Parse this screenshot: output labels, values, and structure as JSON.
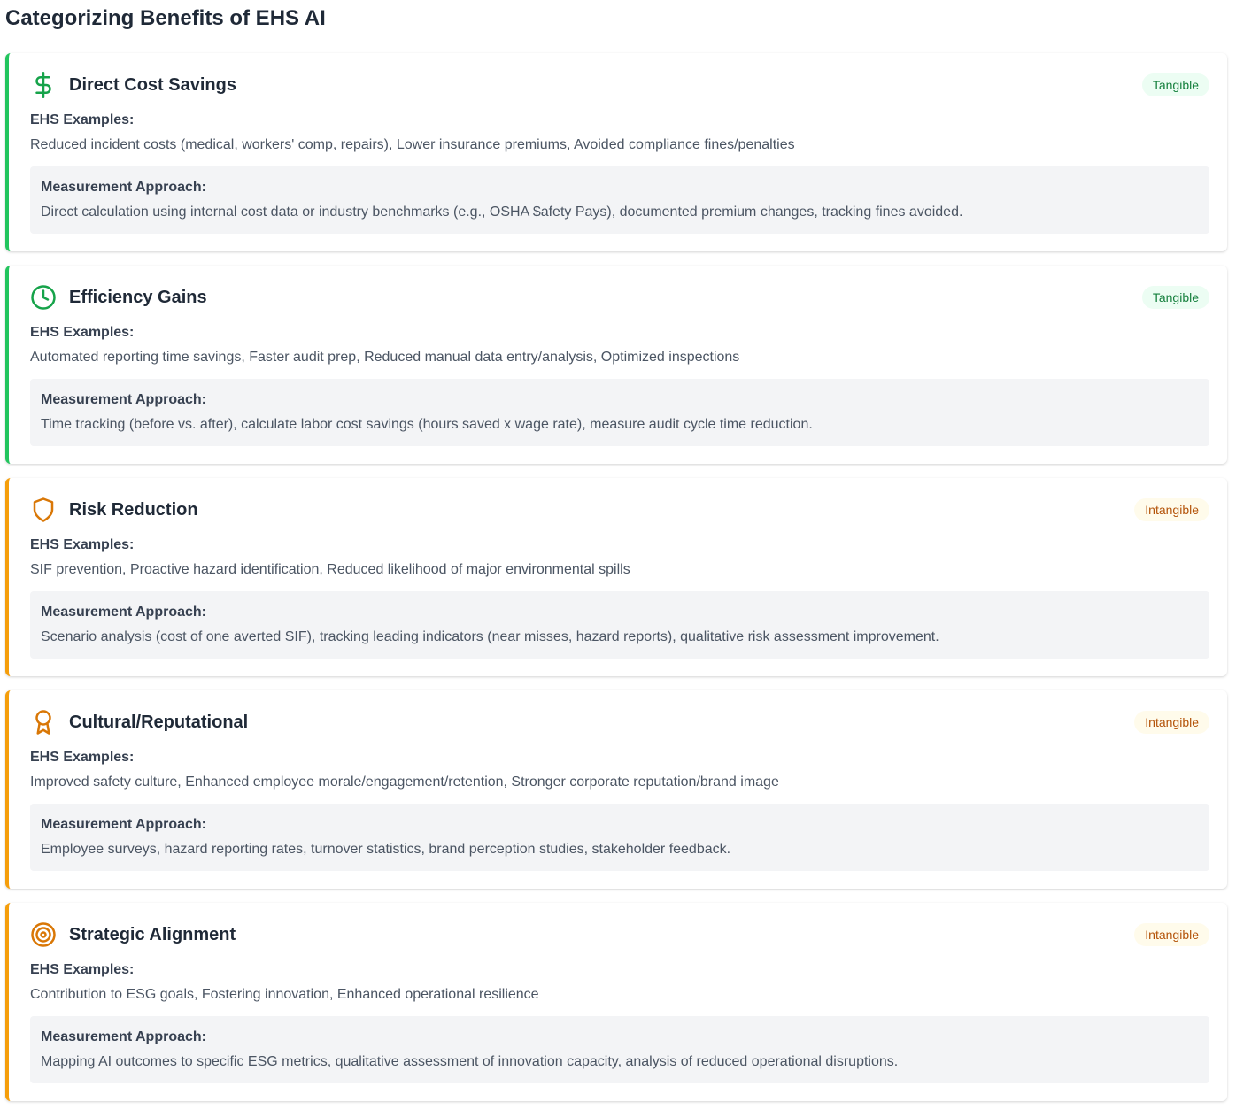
{
  "page": {
    "title": "Categorizing Benefits of EHS AI"
  },
  "colors": {
    "tangible_accent": "#22c55e",
    "intangible_accent": "#f59e0b",
    "tangible_badge_bg": "#ecfdf3",
    "tangible_badge_text": "#15803d",
    "intangible_badge_bg": "#fffbeb",
    "intangible_badge_text": "#b45309",
    "measure_box_bg": "#f3f4f6"
  },
  "labels": {
    "examples": "EHS Examples:",
    "measurement": "Measurement Approach:"
  },
  "cards": [
    {
      "title": "Direct Cost Savings",
      "icon": "dollar-icon",
      "badge": "Tangible",
      "examples": "Reduced incident costs (medical, workers' comp, repairs), Lower insurance premiums, Avoided compliance fines/penalties",
      "measurement": "Direct calculation using internal cost data or industry benchmarks (e.g., OSHA $afety Pays), documented premium changes, tracking fines avoided."
    },
    {
      "title": "Efficiency Gains",
      "icon": "clock-icon",
      "badge": "Tangible",
      "examples": "Automated reporting time savings, Faster audit prep, Reduced manual data entry/analysis, Optimized inspections",
      "measurement": "Time tracking (before vs. after), calculate labor cost savings (hours saved x wage rate), measure audit cycle time reduction."
    },
    {
      "title": "Risk Reduction",
      "icon": "shield-icon",
      "badge": "Intangible",
      "examples": "SIF prevention, Proactive hazard identification, Reduced likelihood of major environmental spills",
      "measurement": "Scenario analysis (cost of one averted SIF), tracking leading indicators (near misses, hazard reports), qualitative risk assessment improvement."
    },
    {
      "title": "Cultural/Reputational",
      "icon": "award-icon",
      "badge": "Intangible",
      "examples": "Improved safety culture, Enhanced employee morale/engagement/retention, Stronger corporate reputation/brand image",
      "measurement": "Employee surveys, hazard reporting rates, turnover statistics, brand perception studies, stakeholder feedback."
    },
    {
      "title": "Strategic Alignment",
      "icon": "target-icon",
      "badge": "Intangible",
      "examples": "Contribution to ESG goals, Fostering innovation, Enhanced operational resilience",
      "measurement": "Mapping AI outcomes to specific ESG metrics, qualitative assessment of innovation capacity, analysis of reduced operational disruptions."
    }
  ]
}
